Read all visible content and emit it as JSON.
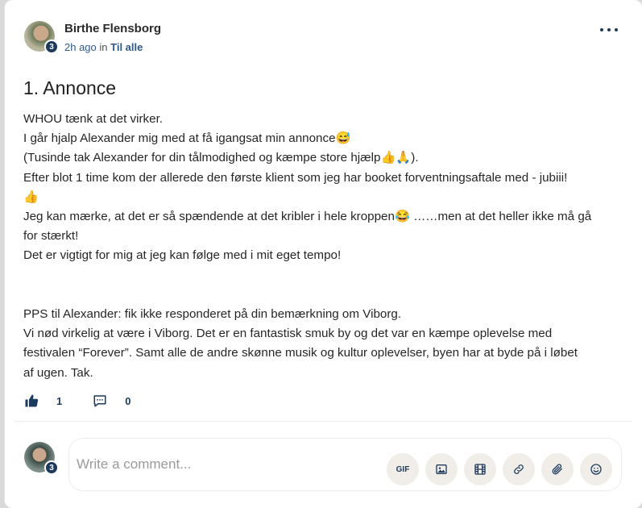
{
  "post": {
    "author": "Birthe Flensborg",
    "author_level": "3",
    "time": "2h ago",
    "in_label": "in",
    "group": "Til alle",
    "title": "1. Annonce",
    "body_lines": [
      "WHOU tænk at det virker.",
      "I går hjalp Alexander mig med at få igangsat min annonce😅",
      " (Tusinde tak Alexander for din tålmodighed og kæmpe store hjælp👍🙏).",
      "Efter blot 1 time kom der allerede den første klient som jeg har booket forventningsaftale med - jubiii!",
      "👍",
      "Jeg kan mærke, at det er så spændende at det kribler i hele kroppen😂 ……men at det heller ikke må gå",
      "for stærkt!",
      "Det er vigtigt for mig at jeg kan følge med i mit eget tempo!",
      "",
      "",
      "PPS til Alexander: fik ikke responderet på din bemærkning om Viborg.",
      "Vi nød virkelig at være i Viborg. Det er en fantastisk smuk by og det var en kæmpe oplevelse med",
      "festivalen “Forever”. Samt alle de andre skønne musik og kultur oplevelser,  byen har at byde på i løbet",
      "af ugen. Tak."
    ],
    "likes": "1",
    "comments": "0"
  },
  "composer": {
    "my_level": "3",
    "placeholder": "Write a comment...",
    "gif_label": "GIF"
  },
  "icons": {
    "like": "thumbs-up-icon",
    "comment": "speech-bubble-icon",
    "more": "more-horizontal-icon",
    "image": "image-icon",
    "video": "film-icon",
    "link": "link-icon",
    "attach": "paperclip-icon",
    "emoji": "smiley-icon"
  },
  "colors": {
    "accent": "#1d3a5c",
    "link": "#2f5a8a",
    "tool_bg": "#f1ede8"
  }
}
